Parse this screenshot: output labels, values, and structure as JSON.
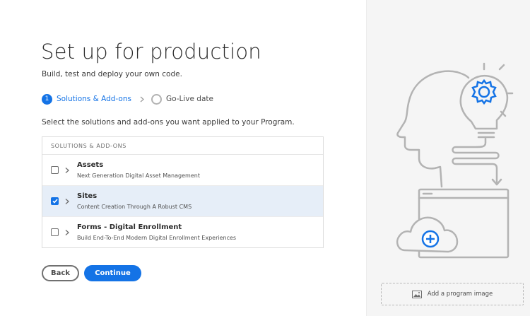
{
  "page": {
    "title": "Set up for production",
    "subtitle": "Build, test and deploy your own code."
  },
  "stepper": {
    "steps": [
      {
        "number": "1",
        "label": "Solutions & Add-ons",
        "state": "active"
      },
      {
        "number": "",
        "label": "Go-Live date",
        "state": "inactive"
      }
    ]
  },
  "prompt": "Select the solutions and add-ons you want applied to your Program.",
  "table": {
    "header": "SOLUTIONS & ADD-ONS",
    "rows": [
      {
        "name": "Assets",
        "description": "Next Generation Digital Asset Management",
        "checked": false
      },
      {
        "name": "Sites",
        "description": "Content Creation Through A Robust CMS",
        "checked": true
      },
      {
        "name": "Forms - Digital Enrollment",
        "description": "Build End-To-End Modern Digital Enrollment Experiences",
        "checked": false
      }
    ]
  },
  "buttons": {
    "back": "Back",
    "continue": "Continue"
  },
  "side_panel": {
    "add_image_label": "Add a program image"
  },
  "colors": {
    "accent": "#1473e6",
    "illustration_gray": "#b3b3b3",
    "selected_row": "#e6eef8"
  }
}
